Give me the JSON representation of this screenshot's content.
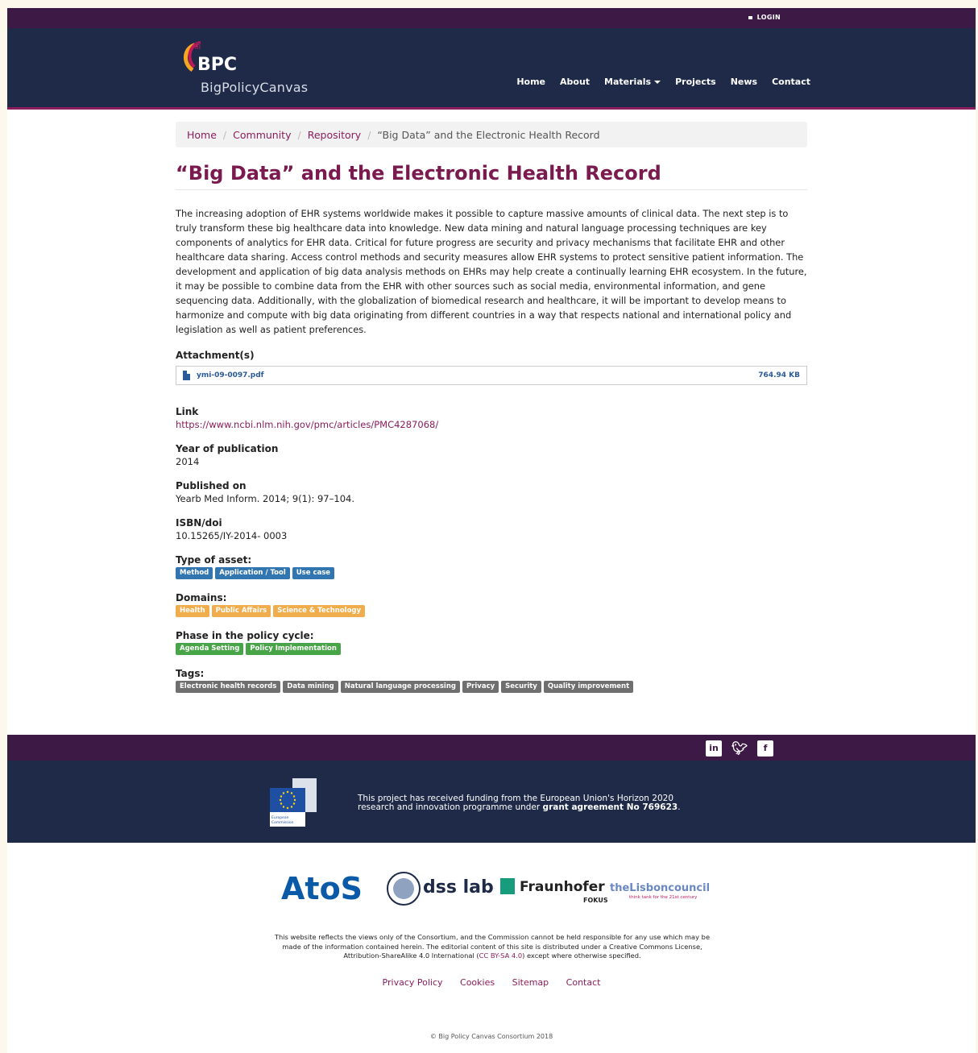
{
  "topbar": {
    "login": "LOGIN"
  },
  "logo": {
    "mark": "BPC",
    "name": "BigPolicyCanvas"
  },
  "nav": {
    "items": [
      "Home",
      "About",
      "Materials",
      "Projects",
      "News",
      "Contact"
    ]
  },
  "breadcrumb": {
    "home": "Home",
    "community": "Community",
    "repository": "Repository",
    "current": "“Big Data” and the Electronic Health Record"
  },
  "page": {
    "title": "“Big Data” and the Electronic Health Record",
    "description": "The increasing adoption of EHR systems worldwide makes it possible to capture massive amounts of clinical data. The next step is to truly transform these big healthcare data into knowledge. New data mining and natural language processing techniques are key components of analytics for EHR data. Critical for future progress are security and privacy mechanisms that facilitate EHR and other healthcare data sharing. Access control methods and security measures allow EHR systems to protect sensitive patient information. The development and application of big data analysis methods on EHRs may help create a continually learning EHR ecosystem. In the future, it may be possible to combine data from the EHR with other sources such as social media, environmental information, and gene sequencing data. Additionally, with the globalization of biomedical research and healthcare, it will be important to develop means to harmonize and compute with big data originating from different countries in a way that respects national and international policy and legislation as well as patient preferences."
  },
  "attachment": {
    "label": "Attachment(s)",
    "file": "ymi-09-0097.pdf",
    "size": "764.94 KB"
  },
  "link": {
    "label": "Link",
    "value": "https://www.ncbi.nlm.nih.gov/pmc/articles/PMC4287068/"
  },
  "year": {
    "label": "Year of publication",
    "value": "2014"
  },
  "published": {
    "label": "Published on",
    "value": "Yearb Med Inform. 2014; 9(1): 97–104."
  },
  "isbn": {
    "label": "ISBN/doi",
    "value": "10.15265/IY-2014- 0003"
  },
  "asset_type": {
    "label": "Type of asset:",
    "items": [
      "Method",
      "Application / Tool",
      "Use case"
    ]
  },
  "domains": {
    "label": "Domains:",
    "items": [
      "Health",
      "Public Affairs",
      "Science & Technology"
    ]
  },
  "phase": {
    "label": "Phase in the policy cycle:",
    "items": [
      "Agenda Setting",
      "Policy Implementation"
    ]
  },
  "tags": {
    "label": "Tags:",
    "items": [
      "Electronic health records",
      "Data mining",
      "Natural language processing",
      "Privacy",
      "Security",
      "Quality improvement"
    ]
  },
  "footer": {
    "eu_text_1": "This project has received funding from the European Union's Horizon 2020 research and innovation programme under ",
    "eu_text_bold": "grant agreement No 769623",
    "eu_text_2": ".",
    "eu_logo_line1": "European",
    "eu_logo_line2": "Commission",
    "partners": [
      "AtoS",
      "dss lab",
      "Fraunhofer",
      "FOKUS",
      "theLisboncouncil",
      "think tank for the 21st century"
    ],
    "disclaimer_1": "This website reflects the views only of the Consortium, and the Commission cannot be held responsible for any use which may be made of the information contained herein. The editorial content of this site is distributed under a Creative Commons License, Attribution-ShareAlike 4.0 International (",
    "disclaimer_cc": "CC BY-SA 4.0",
    "disclaimer_2": ") except where otherwise specified.",
    "links": [
      "Privacy Policy",
      "Cookies",
      "Sitemap",
      "Contact"
    ],
    "copyright": "© Big Policy Canvas Consortium 2018"
  },
  "colors": {
    "purple": "#3d1a45",
    "navy": "#1e2a47",
    "accent": "#8b1d5c",
    "blue_badge": "#3276b1",
    "orange_badge": "#f0ad4e",
    "green_badge": "#47a447",
    "grey_badge": "#6f6f6f"
  }
}
